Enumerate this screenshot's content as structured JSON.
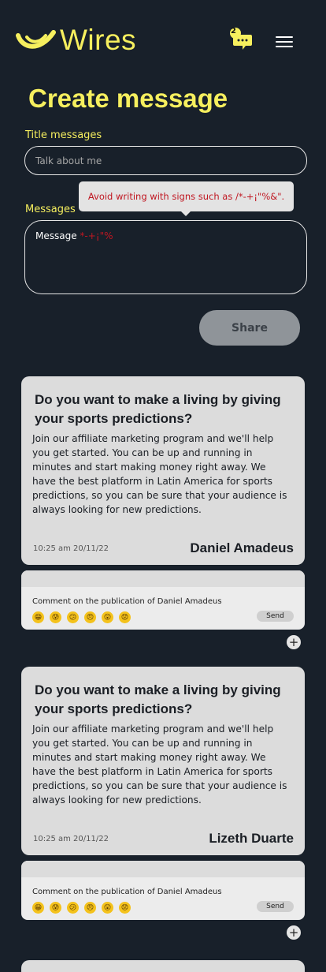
{
  "header": {
    "brand": "Wires",
    "chat_badge": "2"
  },
  "page_title": "Create message",
  "form": {
    "title_label": "Title messages",
    "title_placeholder": "Talk about me",
    "messages_label": "Messages",
    "tooltip": "Avoid writing with signs such as /*-+¡\"%&\".",
    "message_text": "Message",
    "message_invalid": "*-+¡\"%",
    "share_label": "Share"
  },
  "posts": [
    {
      "title": "Do you want to make a living by giving your sports predictions?",
      "body": "Join our affiliate marketing program and we'll help you get started. You can be up and running in minutes and start making money right away. We have the best platform in Latin America for sports predictions, so you can be sure that your audience is always looking for new predictions.",
      "date": "10:25 am 20/11/22",
      "author": "Daniel Amadeus",
      "comment_placeholder": "Comment on the publication of Daniel Amadeus",
      "send_label": "Send"
    },
    {
      "title": "Do you want to make a living by giving your sports predictions?",
      "body": "Join our affiliate marketing program and we'll help you get started. You can be up and running in minutes and start making money right away. We have the best platform in Latin America for sports predictions, so you can be sure that your audience is always looking for new predictions.",
      "date": "10:25 am 20/11/22",
      "author": "Lizeth Duarte",
      "comment_placeholder": "Comment on the publication of Daniel Amadeus",
      "send_label": "Send"
    }
  ],
  "emojis": [
    "grin-emoji",
    "sweat-emoji",
    "confused-emoji",
    "angry-emoji",
    "astonished-emoji",
    "worried-emoji"
  ],
  "colors": {
    "accent": "#f6ef5e",
    "background": "#18202a",
    "error": "#c01722"
  }
}
